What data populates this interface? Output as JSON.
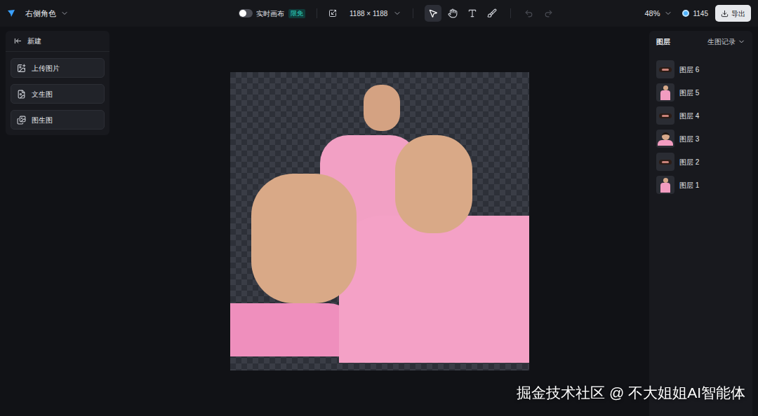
{
  "toolbar": {
    "project": "右侧角色",
    "realtime_canvas": {
      "label": "实时画布",
      "on": false,
      "badge": "限免"
    },
    "size": "1188 × 1188",
    "tools": [
      {
        "kind": "select",
        "selected": true
      },
      {
        "kind": "hand",
        "selected": false
      },
      {
        "kind": "text",
        "selected": false
      },
      {
        "kind": "brush",
        "selected": false
      }
    ],
    "undo_disabled": true,
    "redo_disabled": true,
    "zoom": "48%",
    "credits": "1145",
    "export": "导出"
  },
  "left_panel": {
    "back_label": "新建",
    "items": [
      {
        "label": "上传图片",
        "kind": "upload"
      },
      {
        "label": "文生图",
        "kind": "text2img"
      },
      {
        "label": "图生图",
        "kind": "img2img"
      }
    ]
  },
  "right_panel": {
    "title": "图层",
    "history": "生图记录",
    "layers": [
      {
        "name": "图层 6",
        "kind": "mouth"
      },
      {
        "name": "图层 5",
        "kind": "figure"
      },
      {
        "name": "图层 4",
        "kind": "mouth"
      },
      {
        "name": "图层 3",
        "kind": "portrait"
      },
      {
        "name": "图层 2",
        "kind": "mouth"
      },
      {
        "name": "图层 1",
        "kind": "figure"
      }
    ]
  },
  "watermark": "掘金技术社区 @ 不大姐姐AI智能体"
}
